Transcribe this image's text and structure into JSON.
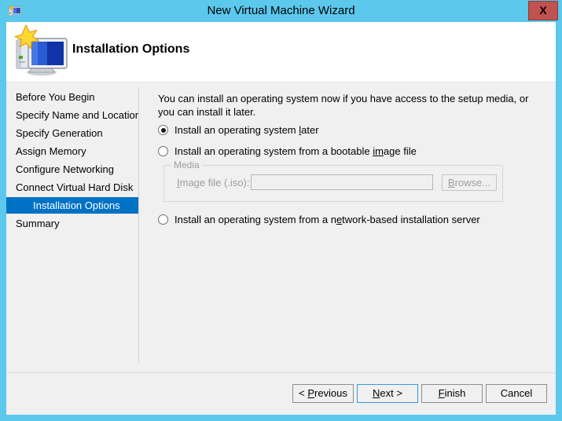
{
  "window": {
    "title": "New Virtual Machine Wizard",
    "title_icon": "vm-wizard-icon",
    "close_label": "X",
    "accent_color": "#5bc8ec",
    "close_color": "#c0534f"
  },
  "header": {
    "title": "Installation Options",
    "icon": "monitor-star-icon"
  },
  "sidebar": {
    "selected_index": 6,
    "highlight_color": "#0072c6",
    "items": [
      {
        "label": "Before You Begin"
      },
      {
        "label": "Specify Name and Location"
      },
      {
        "label": "Specify Generation"
      },
      {
        "label": "Assign Memory"
      },
      {
        "label": "Configure Networking"
      },
      {
        "label": "Connect Virtual Hard Disk"
      },
      {
        "label": "Installation Options"
      },
      {
        "label": "Summary"
      }
    ]
  },
  "content": {
    "intro": "You can install an operating system now if you have access to the setup media, or you can install it later.",
    "options": [
      {
        "label_before": "Install an operating system ",
        "accelerator": "l",
        "label_after": "ater",
        "selected": true
      },
      {
        "label_before": "Install an operating system from a bootable ",
        "accelerator": "im",
        "label_after": "age file",
        "selected": false
      },
      {
        "label_before": "Install an operating system from a n",
        "accelerator": "e",
        "label_after": "twork-based installation server",
        "selected": false
      }
    ],
    "media_group": {
      "legend": "Media",
      "iso_label_before": "",
      "iso_accelerator": "I",
      "iso_label_after": "mage file (.iso):",
      "iso_value": "",
      "iso_placeholder": "",
      "browse_before": "",
      "browse_accelerator": "B",
      "browse_after": "rowse...",
      "disabled": true
    }
  },
  "footer": {
    "buttons": [
      {
        "before": "< ",
        "accelerator": "P",
        "after": "revious",
        "default": false
      },
      {
        "before": "",
        "accelerator": "N",
        "after": "ext >",
        "default": true
      },
      {
        "before": "",
        "accelerator": "F",
        "after": "inish",
        "default": false
      },
      {
        "before": "Cancel",
        "accelerator": "",
        "after": "",
        "default": false
      }
    ]
  }
}
